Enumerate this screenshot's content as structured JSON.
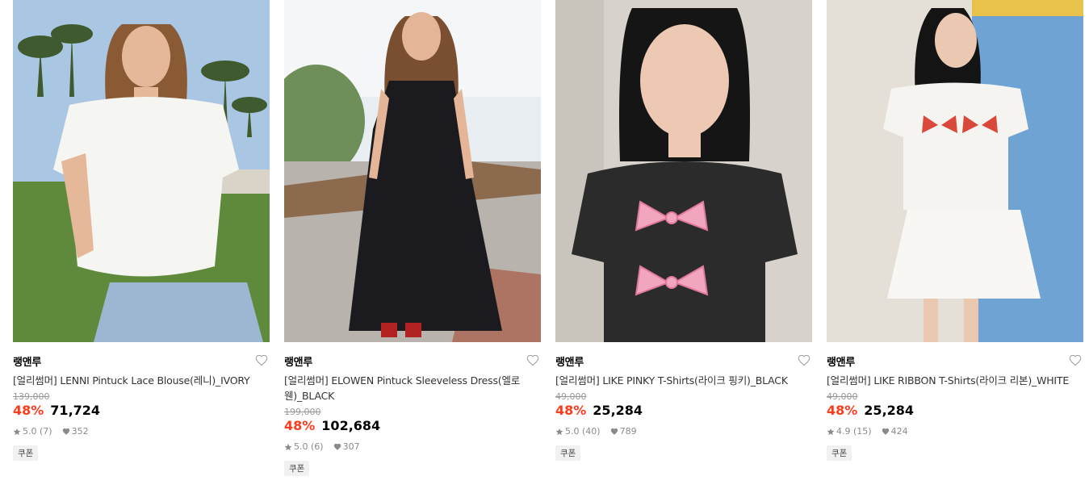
{
  "products": [
    {
      "brand": "랭앤루",
      "name": "[얼리썸머] LENNI Pintuck Lace Blouse(레니)_IVORY",
      "original_price": "139,000",
      "discount": "48%",
      "price": "71,724",
      "rating": "5.0",
      "reviews": "(7)",
      "likes": "352",
      "badge": "쿠폰",
      "image": "model-white-blouse-palm-trees"
    },
    {
      "brand": "랭앤루",
      "name": "[얼리썸머] ELOWEN Pintuck Sleeveless Dress(엘로웬)_BLACK",
      "original_price": "199,000",
      "discount": "48%",
      "price": "102,684",
      "rating": "5.0",
      "reviews": "(6)",
      "likes": "307",
      "badge": "쿠폰",
      "image": "model-black-maxi-dress-patio"
    },
    {
      "brand": "랭앤루",
      "name": "[얼리썸머] LIKE PINKY T-Shirts(라이크 핑키)_BLACK",
      "original_price": "49,000",
      "discount": "48%",
      "price": "25,284",
      "rating": "5.0",
      "reviews": "(40)",
      "likes": "789",
      "badge": "쿠폰",
      "image": "model-black-tshirt-pink-bows"
    },
    {
      "brand": "랭앤루",
      "name": "[얼리썸머] LIKE RIBBON T-Shirts(라이크 리본)_WHITE",
      "original_price": "49,000",
      "discount": "48%",
      "price": "25,284",
      "rating": "4.9",
      "reviews": "(15)",
      "likes": "424",
      "badge": "쿠폰",
      "image": "model-white-tshirt-red-bows"
    }
  ],
  "colors": {
    "discount": "#ff3b1f",
    "original_price": "#999999",
    "meta": "#8a8a8a"
  },
  "icons": {
    "wishlist": "heart-outline-icon",
    "rating": "star-icon",
    "likes": "heart-filled-icon"
  }
}
